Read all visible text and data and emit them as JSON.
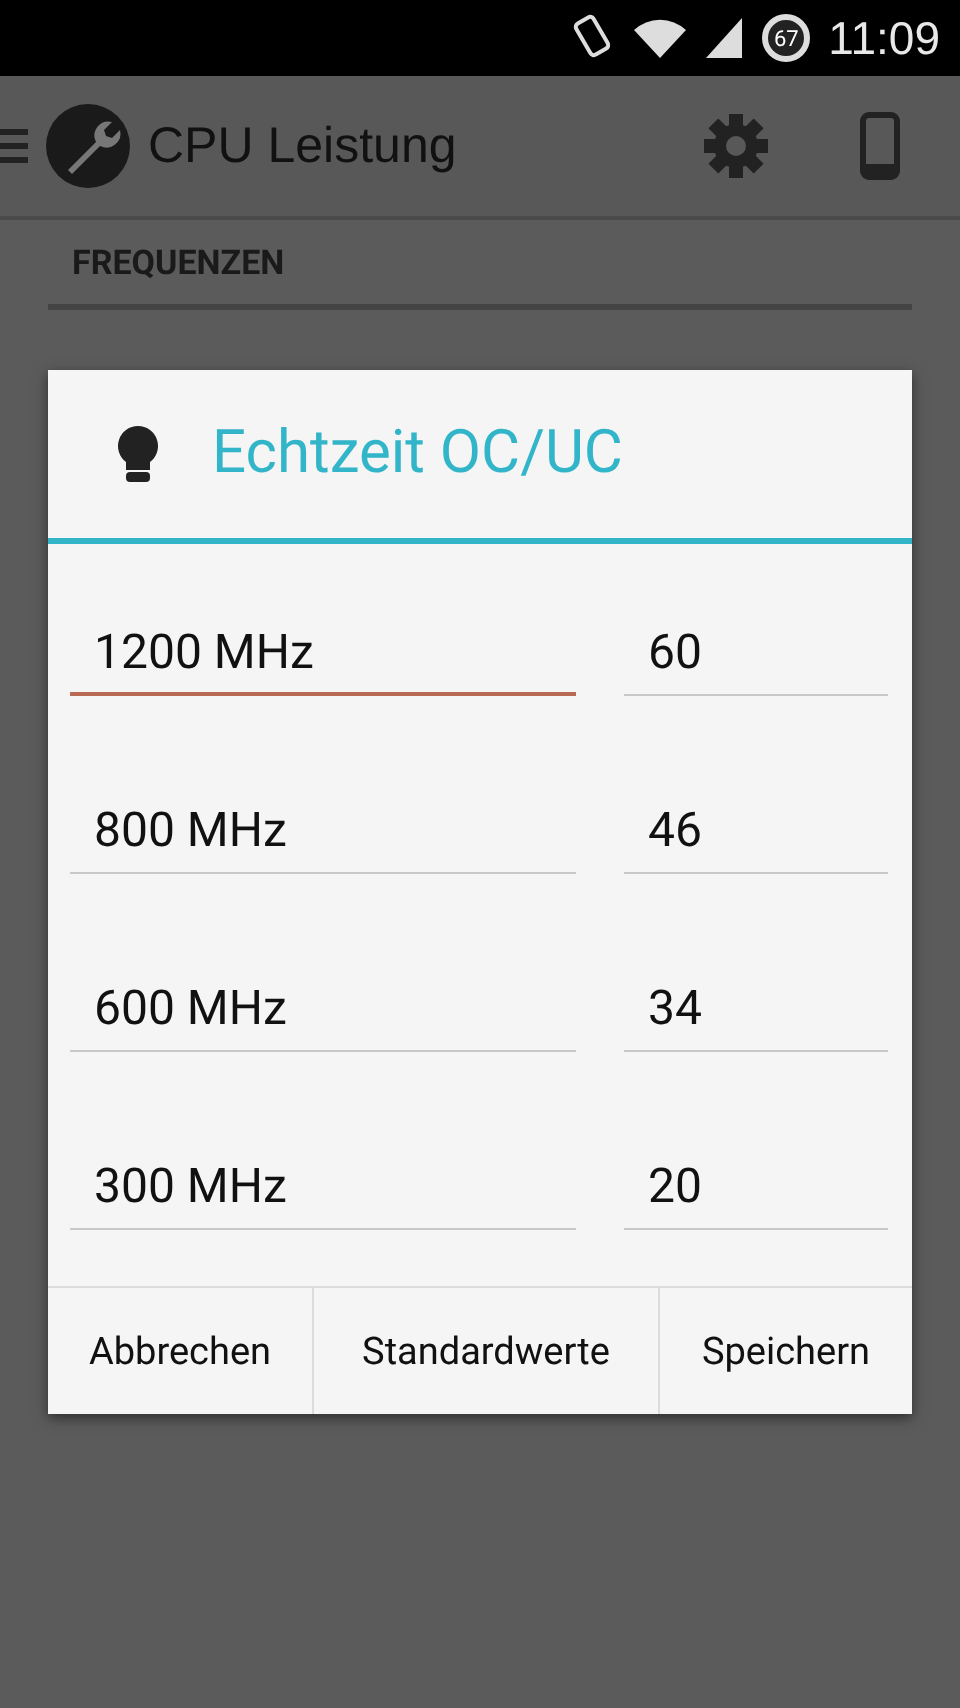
{
  "status_bar": {
    "battery": "67",
    "time": "11:09"
  },
  "app_bar": {
    "title": "CPU Leistung"
  },
  "section": {
    "title": "FREQUENZEN"
  },
  "dialog": {
    "title": "Echtzeit OC/UC",
    "rows": [
      {
        "frequency": "1200 MHz",
        "value": "60",
        "focused": true
      },
      {
        "frequency": "800 MHz",
        "value": "46",
        "focused": false
      },
      {
        "frequency": "600 MHz",
        "value": "34",
        "focused": false
      },
      {
        "frequency": "300 MHz",
        "value": "20",
        "focused": false
      }
    ],
    "buttons": [
      "Abbrechen",
      "Standardwerte",
      "Speichern"
    ]
  }
}
